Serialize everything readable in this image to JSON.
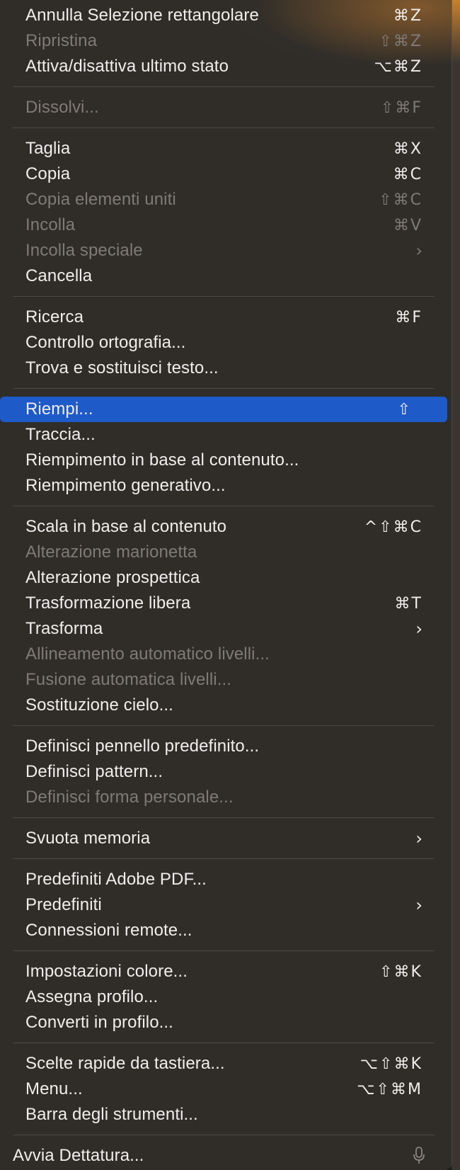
{
  "menu": {
    "items": [
      {
        "label": "Annulla Selezione rettangolare",
        "shortcut": "⌘Z",
        "disabled": false,
        "submenu": false
      },
      {
        "label": "Ripristina",
        "shortcut": "⇧⌘Z",
        "disabled": true,
        "submenu": false
      },
      {
        "label": "Attiva/disattiva ultimo stato",
        "shortcut": "⌥⌘Z",
        "disabled": false,
        "submenu": false
      },
      {
        "separator": true
      },
      {
        "label": "Dissolvi...",
        "shortcut": "⇧⌘F",
        "disabled": true,
        "submenu": false
      },
      {
        "separator": true
      },
      {
        "label": "Taglia",
        "shortcut": "⌘X",
        "disabled": false,
        "submenu": false
      },
      {
        "label": "Copia",
        "shortcut": "⌘C",
        "disabled": false,
        "submenu": false
      },
      {
        "label": "Copia elementi uniti",
        "shortcut": "⇧⌘C",
        "disabled": true,
        "submenu": false
      },
      {
        "label": "Incolla",
        "shortcut": "⌘V",
        "disabled": true,
        "submenu": false
      },
      {
        "label": "Incolla speciale",
        "shortcut": "",
        "disabled": true,
        "submenu": true
      },
      {
        "label": "Cancella",
        "shortcut": "",
        "disabled": false,
        "submenu": false
      },
      {
        "separator": true
      },
      {
        "label": "Ricerca",
        "shortcut": "⌘F",
        "disabled": false,
        "submenu": false
      },
      {
        "label": "Controllo ortografia...",
        "shortcut": "",
        "disabled": false,
        "submenu": false
      },
      {
        "label": "Trova e sostituisci testo...",
        "shortcut": "",
        "disabled": false,
        "submenu": false
      },
      {
        "separator": true
      },
      {
        "label": "Riempi...",
        "shortcut": "⇧",
        "disabled": false,
        "submenu": false,
        "highlighted": true
      },
      {
        "label": "Traccia...",
        "shortcut": "",
        "disabled": false,
        "submenu": false
      },
      {
        "label": "Riempimento in base al contenuto...",
        "shortcut": "",
        "disabled": false,
        "submenu": false
      },
      {
        "label": "Riempimento generativo...",
        "shortcut": "",
        "disabled": false,
        "submenu": false
      },
      {
        "separator": true
      },
      {
        "label": "Scala in base al contenuto",
        "shortcut": "^⇧⌘C",
        "disabled": false,
        "submenu": false
      },
      {
        "label": "Alterazione marionetta",
        "shortcut": "",
        "disabled": true,
        "submenu": false
      },
      {
        "label": "Alterazione prospettica",
        "shortcut": "",
        "disabled": false,
        "submenu": false
      },
      {
        "label": "Trasformazione libera",
        "shortcut": "⌘T",
        "disabled": false,
        "submenu": false
      },
      {
        "label": "Trasforma",
        "shortcut": "",
        "disabled": false,
        "submenu": true
      },
      {
        "label": "Allineamento automatico livelli...",
        "shortcut": "",
        "disabled": true,
        "submenu": false
      },
      {
        "label": "Fusione automatica livelli...",
        "shortcut": "",
        "disabled": true,
        "submenu": false
      },
      {
        "label": "Sostituzione cielo...",
        "shortcut": "",
        "disabled": false,
        "submenu": false
      },
      {
        "separator": true
      },
      {
        "label": "Definisci pennello predefinito...",
        "shortcut": "",
        "disabled": false,
        "submenu": false
      },
      {
        "label": "Definisci pattern...",
        "shortcut": "",
        "disabled": false,
        "submenu": false
      },
      {
        "label": "Definisci forma personale...",
        "shortcut": "",
        "disabled": true,
        "submenu": false
      },
      {
        "separator": true
      },
      {
        "label": "Svuota memoria",
        "shortcut": "",
        "disabled": false,
        "submenu": true
      },
      {
        "separator": true
      },
      {
        "label": "Predefiniti Adobe PDF...",
        "shortcut": "",
        "disabled": false,
        "submenu": false
      },
      {
        "label": "Predefiniti",
        "shortcut": "",
        "disabled": false,
        "submenu": true
      },
      {
        "label": "Connessioni remote...",
        "shortcut": "",
        "disabled": false,
        "submenu": false
      },
      {
        "separator": true
      },
      {
        "label": "Impostazioni colore...",
        "shortcut": "⇧⌘K",
        "disabled": false,
        "submenu": false
      },
      {
        "label": "Assegna profilo...",
        "shortcut": "",
        "disabled": false,
        "submenu": false
      },
      {
        "label": "Converti in profilo...",
        "shortcut": "",
        "disabled": false,
        "submenu": false
      },
      {
        "separator": true
      },
      {
        "label": "Scelte rapide da tastiera...",
        "shortcut": "⌥⇧⌘K",
        "disabled": false,
        "submenu": false
      },
      {
        "label": "Menu...",
        "shortcut": "⌥⇧⌘M",
        "disabled": false,
        "submenu": false
      },
      {
        "label": "Barra degli strumenti...",
        "shortcut": "",
        "disabled": false,
        "submenu": false
      },
      {
        "separator": true
      },
      {
        "label": "Avvia Dettatura...",
        "shortcut": "",
        "disabled": false,
        "submenu": false,
        "icon": "microphone-icon"
      }
    ],
    "submenu_glyph": "›"
  },
  "colors": {
    "highlight": "#1e5ac8",
    "text": "#f0eeec",
    "disabled_text": "#7f7a75",
    "menu_bg": "#322e2a",
    "accent_glow": "#d68c28"
  }
}
